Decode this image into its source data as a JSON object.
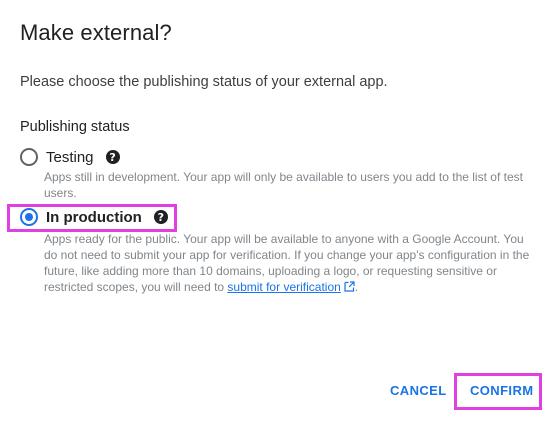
{
  "dialog": {
    "title": "Make external?",
    "intro": "Please choose the publishing status of your external app.",
    "section_label": "Publishing status"
  },
  "options": [
    {
      "label": "Testing",
      "selected": false,
      "description": "Apps still in development. Your app will only be available to users you add to the list of test users."
    },
    {
      "label": "In production",
      "selected": true,
      "description_prefix": "Apps ready for the public. Your app will be available to anyone with a Google Account. You do not need to submit your app for verification. If you change your app's configuration in the future, like adding more than 10 domains, uploading a logo, or requesting sensitive or restricted scopes, you will need to ",
      "link_text": "submit for verification",
      "description_suffix": "."
    }
  ],
  "actions": {
    "cancel": "CANCEL",
    "confirm": "CONFIRM"
  },
  "icons": {
    "help": "help-circle-icon",
    "external_link": "open-in-new-icon"
  },
  "colors": {
    "accent": "#1a73e8",
    "highlight": "#e040e0",
    "text_primary": "#202124",
    "text_secondary": "#80868b"
  }
}
